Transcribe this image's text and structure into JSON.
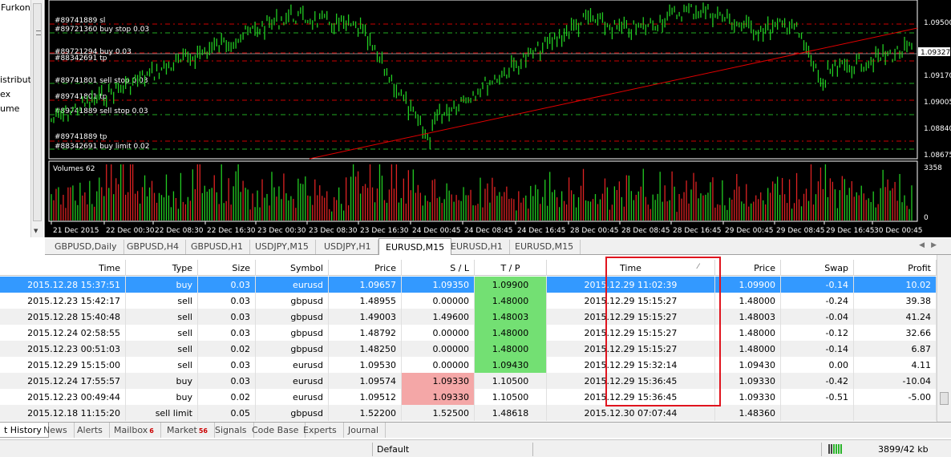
{
  "navigator": {
    "items": [
      "Furkon",
      "istribut",
      "ex",
      "ume"
    ]
  },
  "chart": {
    "price_labels": [
      "1.09500",
      "1.09327",
      "1.09170",
      "1.09005",
      "1.08840",
      "1.08675"
    ],
    "order_labels": [
      "#89741889 sl",
      "#89721360 buy stop 0.03",
      "#89721294 buy 0.03",
      "#88342691 tp",
      "#89741801 sell stop 0.03",
      "#89741801 tp",
      "#89741889 sell stop 0.03",
      "#89741889 tp",
      "#88342691 buy limit 0.02"
    ],
    "volumes_label": "Volumes 62",
    "volume_axis": [
      "3358",
      "0"
    ],
    "time_labels": [
      "21 Dec 2015",
      "22 Dec 00:30",
      "22 Dec 08:30",
      "22 Dec 16:30",
      "23 Dec 00:30",
      "23 Dec 08:30",
      "23 Dec 16:30",
      "24 Dec 00:45",
      "24 Dec 08:45",
      "24 Dec 16:45",
      "28 Dec 00:45",
      "28 Dec 08:45",
      "28 Dec 16:45",
      "29 Dec 00:45",
      "29 Dec 08:45",
      "29 Dec 16:45",
      "30 Dec 00:45"
    ],
    "colors": {
      "candle": "#22cc22",
      "trend": "#e00000",
      "order_line": "#cc0000",
      "tp_line": "#22aa22"
    }
  },
  "chart_tabs": [
    "GBPUSD,Daily",
    "GBPUSD,H4",
    "GBPUSD,H1",
    "USDJPY,M15",
    "USDJPY,H1",
    "EURUSD,M15",
    "EURUSD,H1",
    "EURUSD,M15"
  ],
  "active_chart_tab": 5,
  "table": {
    "headers": [
      "Time",
      "Type",
      "Size",
      "Symbol",
      "Price",
      "S / L",
      "T / P",
      "Time",
      "Price",
      "Swap",
      "Profit"
    ],
    "rows": [
      [
        "2015.12.28 15:37:51",
        "buy",
        "0.03",
        "eurusd",
        "1.09657",
        "1.09350",
        "1.09900",
        "2015.12.29 11:02:39",
        "1.09900",
        "-0.14",
        "10.02"
      ],
      [
        "2015.12.23 15:42:17",
        "sell",
        "0.03",
        "gbpusd",
        "1.48955",
        "0.00000",
        "1.48000",
        "2015.12.29 15:15:27",
        "1.48000",
        "-0.24",
        "39.38"
      ],
      [
        "2015.12.28 15:40:48",
        "sell",
        "0.03",
        "gbpusd",
        "1.49003",
        "1.49600",
        "1.48003",
        "2015.12.29 15:15:27",
        "1.48003",
        "-0.04",
        "41.24"
      ],
      [
        "2015.12.24 02:58:55",
        "sell",
        "0.03",
        "gbpusd",
        "1.48792",
        "0.00000",
        "1.48000",
        "2015.12.29 15:15:27",
        "1.48000",
        "-0.12",
        "32.66"
      ],
      [
        "2015.12.23 00:51:03",
        "sell",
        "0.02",
        "gbpusd",
        "1.48250",
        "0.00000",
        "1.48000",
        "2015.12.29 15:15:27",
        "1.48000",
        "-0.14",
        "6.87"
      ],
      [
        "2015.12.29 15:15:00",
        "sell",
        "0.03",
        "eurusd",
        "1.09530",
        "0.00000",
        "1.09430",
        "2015.12.29 15:32:14",
        "1.09430",
        "0.00",
        "4.11"
      ],
      [
        "2015.12.24 17:55:57",
        "buy",
        "0.03",
        "eurusd",
        "1.09574",
        "1.09330",
        "1.10500",
        "2015.12.29 15:36:45",
        "1.09330",
        "-0.42",
        "-10.04"
      ],
      [
        "2015.12.23 00:49:44",
        "buy",
        "0.02",
        "eurusd",
        "1.09512",
        "1.09330",
        "1.10500",
        "2015.12.29 15:36:45",
        "1.09330",
        "-0.51",
        "-5.00"
      ],
      [
        "2015.12.18 11:15:20",
        "sell limit",
        "0.05",
        "gbpusd",
        "1.52200",
        "1.52500",
        "1.48618",
        "2015.12.30 07:07:44",
        "1.48360",
        "",
        ""
      ]
    ],
    "tp_green_rows": [
      0,
      1,
      2,
      3,
      4,
      5
    ],
    "sl_red_rows": [
      6,
      7
    ],
    "selected_row": 0
  },
  "bottom_tabs": [
    {
      "label": "t History",
      "badge": ""
    },
    {
      "label": "News",
      "badge": ""
    },
    {
      "label": "Alerts",
      "badge": ""
    },
    {
      "label": "Mailbox",
      "badge": "6"
    },
    {
      "label": "Market",
      "badge": "56"
    },
    {
      "label": "Signals",
      "badge": ""
    },
    {
      "label": "Code Base",
      "badge": ""
    },
    {
      "label": "Experts",
      "badge": ""
    },
    {
      "label": "Journal",
      "badge": ""
    }
  ],
  "status": {
    "profile": "Default",
    "traffic": "3899/42 kb"
  }
}
